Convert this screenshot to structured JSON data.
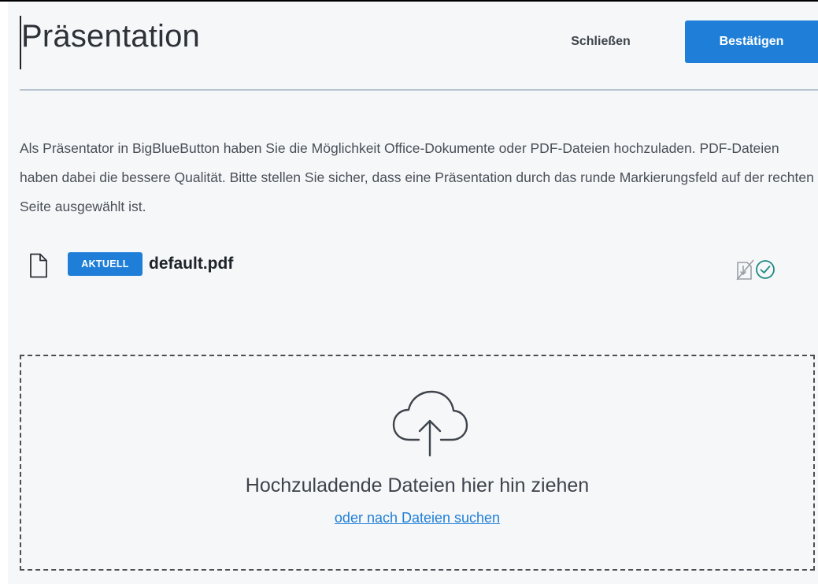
{
  "header": {
    "title": "Präsentation",
    "close_label": "Schließen",
    "confirm_label": "Bestätigen"
  },
  "description": "Als Präsentator in BigBlueButton haben Sie die Möglichkeit Office-Dokumente oder PDF-Dateien hochzuladen. PDF-Dateien haben dabei die bessere Qualität. Bitte stellen Sie sicher, dass eine Präsentation durch das runde Markierungsfeld auf der rechten Seite ausgewählt ist.",
  "files": [
    {
      "icon": "file-icon",
      "badge": "AKTUELL",
      "name": "default.pdf",
      "download_disabled": true,
      "selected": true
    }
  ],
  "dropzone": {
    "icon": "cloud-upload-icon",
    "text": "Hochzuladende Dateien hier hin ziehen",
    "link": "oder nach Dateien suchen"
  },
  "colors": {
    "accent": "#1f7fd8",
    "check": "#1a8a80",
    "background": "#f6f7f9"
  }
}
